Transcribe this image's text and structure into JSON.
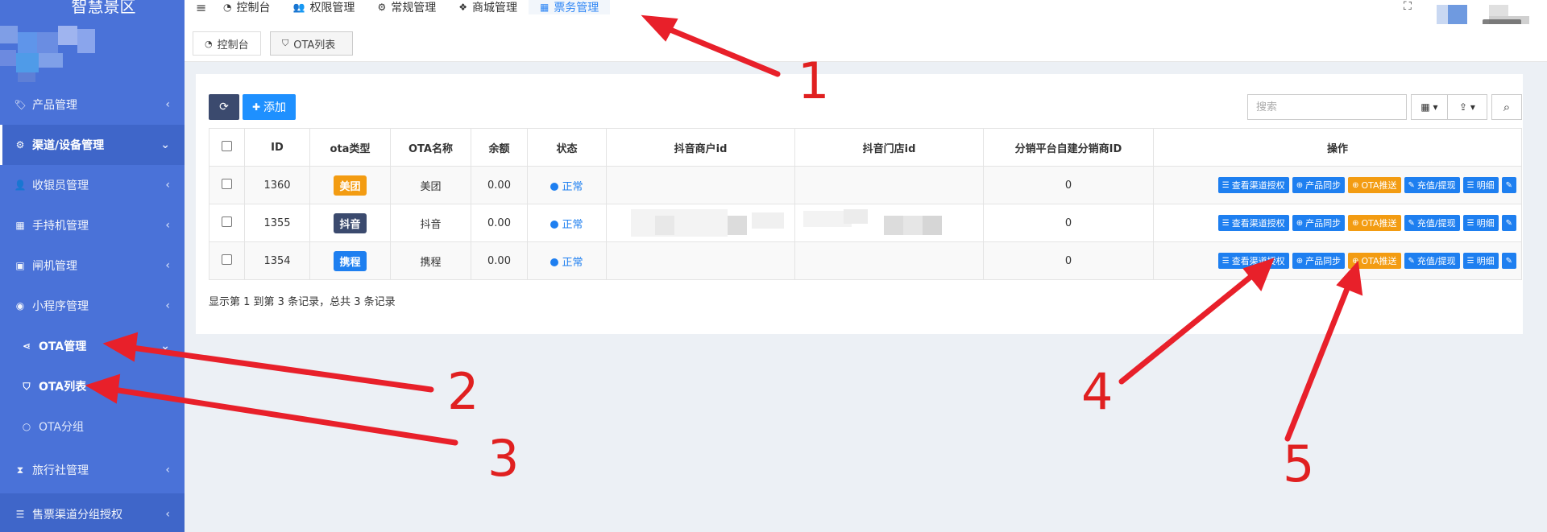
{
  "brand": "智慧景区",
  "sidebar": {
    "items": [
      {
        "label": "产品管理",
        "icon": "tag-icon",
        "glyph": "🏷",
        "chevron": "‹"
      },
      {
        "label": "渠道/设备管理",
        "icon": "cogs-icon",
        "glyph": "⚙",
        "chevron": "⌄"
      },
      {
        "label": "收银员管理",
        "icon": "user-icon",
        "glyph": "👤",
        "chevron": "‹"
      },
      {
        "label": "手持机管理",
        "icon": "briefcase-icon",
        "glyph": "▦",
        "chevron": "‹"
      },
      {
        "label": "闸机管理",
        "icon": "gate-icon",
        "glyph": "▣",
        "chevron": "‹"
      },
      {
        "label": "小程序管理",
        "icon": "wechat-icon",
        "glyph": "◉",
        "chevron": "‹"
      },
      {
        "label": "OTA管理",
        "icon": "share-icon",
        "glyph": "⋖",
        "chevron": "⌄"
      },
      {
        "label": "OTA列表",
        "icon": "shield-icon",
        "glyph": "⛉",
        "chevron": ""
      },
      {
        "label": "OTA分组",
        "icon": "circle-icon",
        "glyph": "○",
        "chevron": ""
      },
      {
        "label": "旅行社管理",
        "icon": "hourglass-icon",
        "glyph": "⧗",
        "chevron": "‹"
      },
      {
        "label": "售票渠道分组授权",
        "icon": "database-icon",
        "glyph": "☰",
        "chevron": "‹"
      }
    ]
  },
  "topnav": {
    "hamburger": "≡",
    "items": [
      {
        "label": "控制台",
        "glyph": "◔"
      },
      {
        "label": "权限管理",
        "glyph": "👥"
      },
      {
        "label": "常规管理",
        "glyph": "⚙"
      },
      {
        "label": "商城管理",
        "glyph": "❖"
      },
      {
        "label": "票务管理",
        "glyph": "▦"
      }
    ],
    "expand": "⛶"
  },
  "close_glyph": "✕",
  "tabs": [
    {
      "label": "控制台",
      "glyph": "◔"
    },
    {
      "label": "OTA列表",
      "glyph": "⛉"
    }
  ],
  "toolbar": {
    "refresh_glyph": "⟳",
    "add_label": "添加",
    "add_glyph": "✚",
    "search_placeholder": "搜索",
    "columns_glyph": "▦ ▾",
    "export_glyph": "⇪ ▾",
    "search_glyph": "⌕"
  },
  "table": {
    "headers": [
      "ID",
      "ota类型",
      "OTA名称",
      "余额",
      "状态",
      "抖音商户id",
      "抖音门店id",
      "分销平台自建分销商ID",
      "操作"
    ],
    "rows": [
      {
        "id": "1360",
        "type": "美团",
        "type_color": "#f39c12",
        "name": "美团",
        "balance": "0.00",
        "status": "正常",
        "merchant": "",
        "store": "",
        "dist": "0"
      },
      {
        "id": "1355",
        "type": "抖音",
        "type_color": "#3b4a6e",
        "name": "抖音",
        "balance": "0.00",
        "status": "正常",
        "merchant": "",
        "store": "",
        "dist": "0"
      },
      {
        "id": "1354",
        "type": "携程",
        "type_color": "#1e7ff0",
        "name": "携程",
        "balance": "0.00",
        "status": "正常",
        "merchant": "",
        "store": "",
        "dist": "0"
      }
    ],
    "ops": [
      {
        "label": "查看渠道授权",
        "glyph": "☰",
        "color": "blue"
      },
      {
        "label": "产品同步",
        "glyph": "⊕",
        "color": "blue"
      },
      {
        "label": "OTA推送",
        "glyph": "⊕",
        "color": "orange"
      },
      {
        "label": "充值/提现",
        "glyph": "✎",
        "color": "blue"
      },
      {
        "label": "明细",
        "glyph": "☰",
        "color": "blue"
      },
      {
        "label": "",
        "glyph": "✎",
        "color": "blue"
      }
    ]
  },
  "summary": "显示第 1 到第 3 条记录，总共 3 条记录",
  "annotations": [
    "1",
    "2",
    "3",
    "4",
    "5"
  ]
}
